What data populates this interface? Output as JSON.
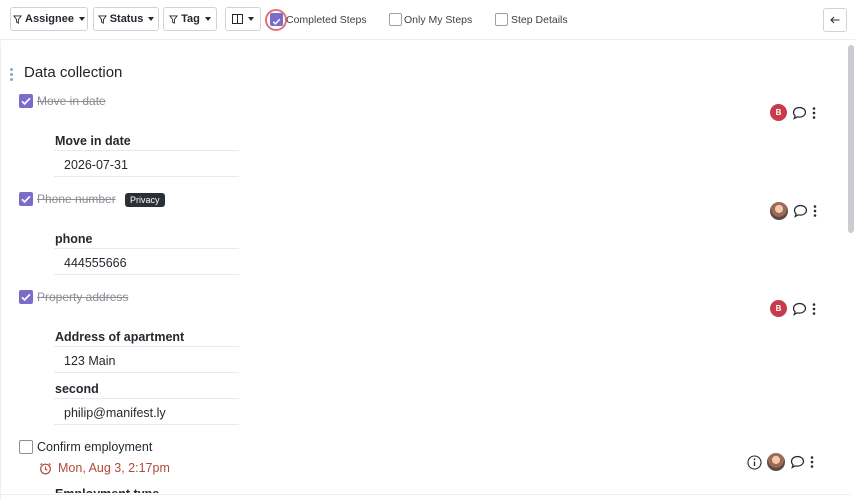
{
  "toolbar": {
    "filters": [
      {
        "label": "Assignee",
        "icon": "filter-icon"
      },
      {
        "label": "Status",
        "icon": "filter-icon"
      },
      {
        "label": "Tag",
        "icon": "filter-icon"
      }
    ],
    "columns_icon": "columns-icon",
    "checkboxes": [
      {
        "label": "Completed Steps",
        "checked": true
      },
      {
        "label": "Only My Steps",
        "checked": false
      },
      {
        "label": "Step Details",
        "checked": false
      }
    ],
    "back_icon": "arrow-left-icon"
  },
  "section": {
    "title": "Data collection"
  },
  "steps": [
    {
      "title": "Move in date",
      "completed": true,
      "assignee_initial": "B",
      "fields": [
        {
          "label": "Move in date",
          "value": "2026-07-31"
        }
      ]
    },
    {
      "title": "Phone number",
      "completed": true,
      "badge": "Privacy",
      "assignee_photo": true,
      "fields": [
        {
          "label": "phone",
          "value": "444555666"
        }
      ]
    },
    {
      "title": "Property address",
      "completed": true,
      "assignee_initial": "B",
      "fields": [
        {
          "label": "Address of apartment",
          "value": "123 Main"
        },
        {
          "label": "second",
          "value": "philip@manifest.ly"
        }
      ]
    },
    {
      "title": "Confirm employment",
      "completed": false,
      "due": "Mon, Aug 3, 2:17pm",
      "next_field_label": "Employment type"
    }
  ],
  "colors": {
    "accent": "#7b6ccb",
    "avatar_b": "#c73b4b",
    "due": "#b04a3a"
  }
}
